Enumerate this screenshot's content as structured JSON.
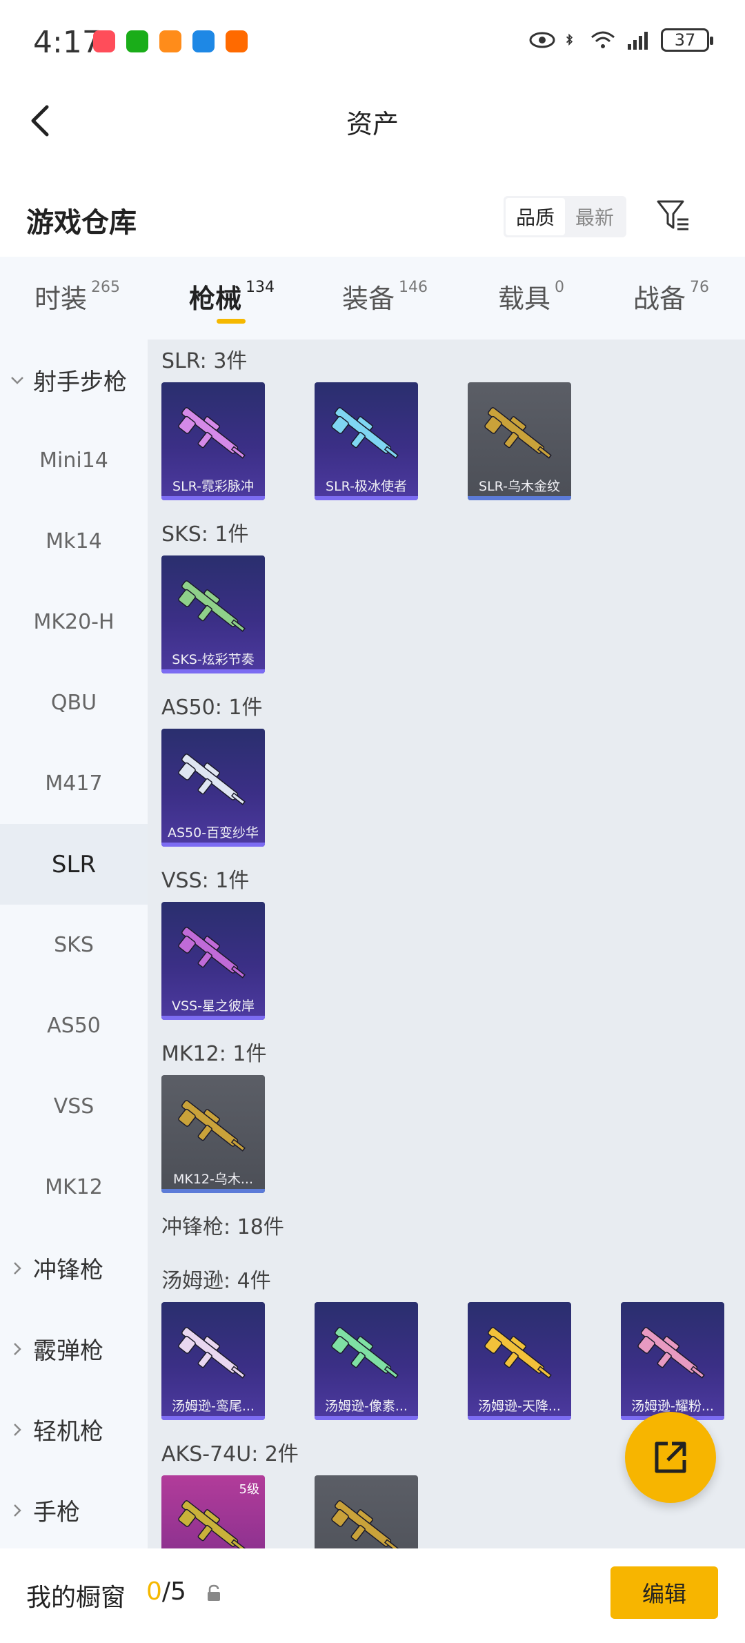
{
  "status_bar": {
    "time": "4:17",
    "battery": "37",
    "app_icons": [
      {
        "name": "shop-app-icon",
        "color": "#ff4d5a"
      },
      {
        "name": "wechat-app-icon",
        "color": "#1aad19"
      },
      {
        "name": "game-app-icon",
        "color": "#ff8c1a"
      },
      {
        "name": "browser-app-icon",
        "color": "#1e88e5"
      },
      {
        "name": "video-app-icon",
        "color": "#ff6a00"
      }
    ]
  },
  "header": {
    "title": "资产"
  },
  "warehouse": {
    "title": "游戏仓库",
    "sort_options": [
      "品质",
      "最新"
    ],
    "sort_selected": "品质"
  },
  "tabs": [
    {
      "label": "时装",
      "count": "265"
    },
    {
      "label": "枪械",
      "count": "134",
      "active": true
    },
    {
      "label": "装备",
      "count": "146"
    },
    {
      "label": "载具",
      "count": "0"
    },
    {
      "label": "战备",
      "count": "76"
    }
  ],
  "sidebar": [
    {
      "label": "射手步枪",
      "type": "group",
      "expanded": true
    },
    {
      "label": "Mini14",
      "type": "item"
    },
    {
      "label": "Mk14",
      "type": "item"
    },
    {
      "label": "MK20-H",
      "type": "item"
    },
    {
      "label": "QBU",
      "type": "item"
    },
    {
      "label": "M417",
      "type": "item"
    },
    {
      "label": "SLR",
      "type": "item",
      "selected": true
    },
    {
      "label": "SKS",
      "type": "item"
    },
    {
      "label": "AS50",
      "type": "item"
    },
    {
      "label": "VSS",
      "type": "item"
    },
    {
      "label": "MK12",
      "type": "item"
    },
    {
      "label": "冲锋枪",
      "type": "group",
      "expanded": false
    },
    {
      "label": "霰弹枪",
      "type": "group",
      "expanded": false
    },
    {
      "label": "轻机枪",
      "type": "group",
      "expanded": false
    },
    {
      "label": "手枪",
      "type": "group",
      "expanded": false
    }
  ],
  "content": {
    "sections": [
      {
        "title": "SLR: 3件",
        "items": [
          {
            "label": "SLR-霓彩脉冲",
            "style": "purple",
            "gun_color": "#d58ae8"
          },
          {
            "label": "SLR-极冰使者",
            "style": "purple",
            "gun_color": "#7fd6f2"
          },
          {
            "label": "SLR-乌木金纹",
            "style": "gray",
            "gun_color": "#c9a23a"
          }
        ]
      },
      {
        "title": "SKS: 1件",
        "items": [
          {
            "label": "SKS-炫彩节奏",
            "style": "purple",
            "gun_color": "#8fd18a"
          }
        ]
      },
      {
        "title": "AS50: 1件",
        "items": [
          {
            "label": "AS50-百变纱华",
            "style": "purple",
            "gun_color": "#dfe6f2"
          }
        ]
      },
      {
        "title": "VSS: 1件",
        "items": [
          {
            "label": "VSS-星之彼岸",
            "style": "purple",
            "gun_color": "#c06bd8"
          }
        ]
      },
      {
        "title": "MK12: 1件",
        "items": [
          {
            "label": "MK12-乌木...",
            "style": "gray",
            "gun_color": "#c9a23a"
          }
        ]
      },
      {
        "title": "冲锋枪: 18件",
        "items": []
      },
      {
        "title": "汤姆逊: 4件",
        "items": [
          {
            "label": "汤姆逊-鸾尾...",
            "style": "purple",
            "gun_color": "#e9d7f0"
          },
          {
            "label": "汤姆逊-像素...",
            "style": "purple",
            "gun_color": "#7fe0a4"
          },
          {
            "label": "汤姆逊-天降...",
            "style": "purple",
            "gun_color": "#f2c13a"
          },
          {
            "label": "汤姆逊-耀粉...",
            "style": "purple",
            "gun_color": "#e89ac2"
          }
        ]
      },
      {
        "title": "AKS-74U: 2件",
        "items": [
          {
            "label": "",
            "style": "pink",
            "gun_color": "#c9b23a",
            "level": "5级"
          },
          {
            "label": "",
            "style": "gray",
            "gun_color": "#c9a23a"
          }
        ]
      }
    ]
  },
  "bottom_bar": {
    "label": "我的橱窗",
    "current": "0",
    "total": "/5",
    "edit_label": "编辑"
  },
  "colors": {
    "accent": "#f7b500",
    "sidebar_bg": "#f5f8fc",
    "content_bg": "#e8ecf1"
  }
}
